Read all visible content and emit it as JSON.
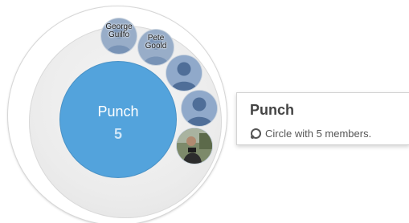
{
  "circle": {
    "name": "Punch",
    "member_count": "5",
    "accent_color": "#53a3dc"
  },
  "members": [
    {
      "label": "George Guilford",
      "line1": "George",
      "line2": "Guilfo",
      "avatar": "person-silhouette-icon"
    },
    {
      "label": "Pete Goold",
      "line1": "Pete",
      "line2": "Goold",
      "avatar": "person-silhouette-icon"
    },
    {
      "label": "",
      "avatar": "person-silhouette-icon"
    },
    {
      "label": "",
      "avatar": "person-silhouette-icon"
    },
    {
      "label": "",
      "avatar": "photo-avatar"
    }
  ],
  "card": {
    "title": "Punch",
    "subtitle": "Circle with 5 members.",
    "icon": "circle-icon"
  }
}
